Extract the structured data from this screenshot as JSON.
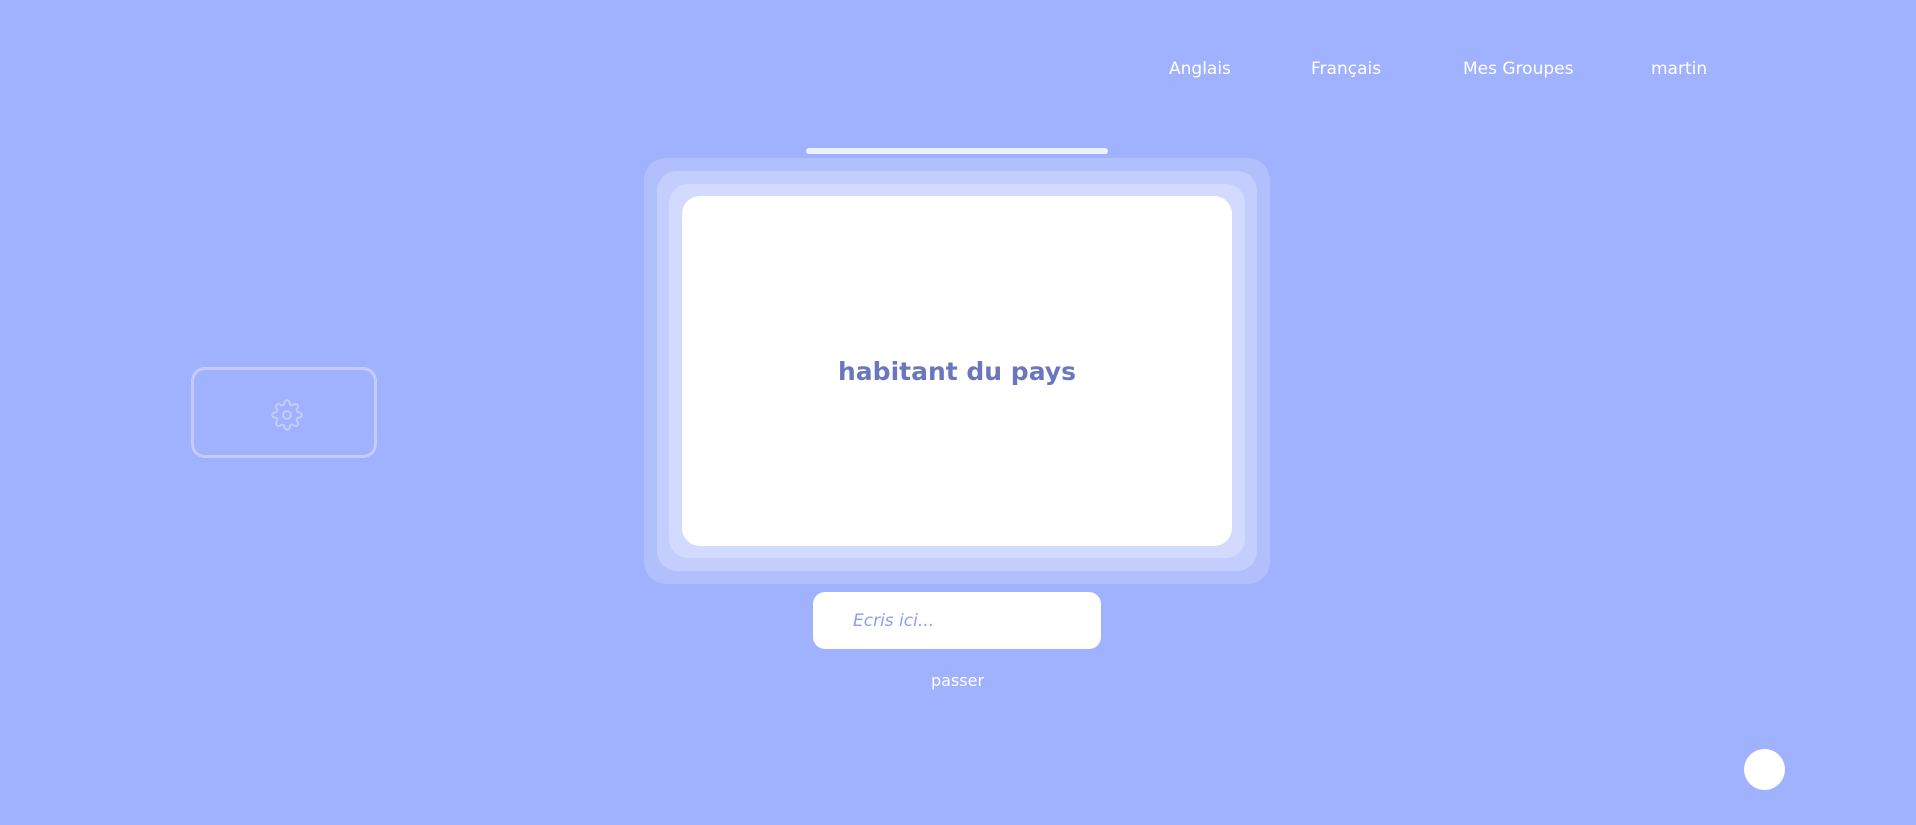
{
  "nav": {
    "items": [
      {
        "label": "Anglais"
      },
      {
        "label": "Français"
      },
      {
        "label": "Mes Groupes"
      },
      {
        "label": "martin"
      }
    ]
  },
  "settings": {
    "icon": "gear-icon"
  },
  "progress": {
    "value": 1.0
  },
  "card": {
    "word": "habitant du pays"
  },
  "answer": {
    "placeholder": "Ecris ici...",
    "value": ""
  },
  "skip": {
    "label": "passer"
  },
  "colors": {
    "background": "#a0b1fd",
    "card_text": "#6a76bd",
    "placeholder": "#8c9cf3"
  }
}
